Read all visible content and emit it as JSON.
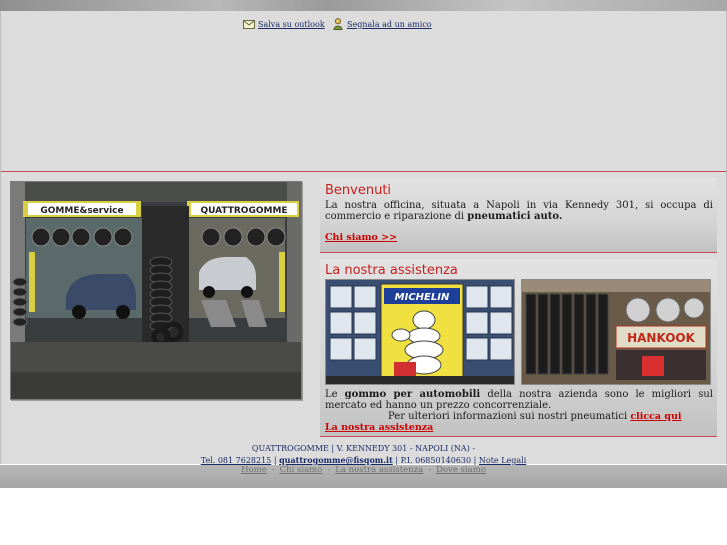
{
  "toplinks": {
    "outlook": "Salva su outlook",
    "friend": "Segnala ad un amico"
  },
  "welcome": {
    "title": "Benvenuti",
    "text_a": "La nostra officina, situata a Napoli in via Kennedy 301, si occupa di commercio e riparazione di ",
    "text_bold": "pneumatici auto.",
    "link": "Chi siamo >>"
  },
  "assist": {
    "title": "La nostra assistenza",
    "text_pre": "Le ",
    "text_bold": "gommo per automobili",
    "text_post": " della nostra azienda sono le migliori sul mercato ed hanno un prezzo concorrenziale.",
    "more": "Per ulteriori informazioni sui nostri pneumatici ",
    "more_link": "clicca qui",
    "link": "La nostra assistenza"
  },
  "photo_signs": {
    "left": "GOMME&service",
    "right": "QUATTROGOMME"
  },
  "thumbs": {
    "michelin": "MICHELIN",
    "hankook": "HANKOOK"
  },
  "footer": {
    "line1": "QUATTROGOMME | V. KENNEDY 301 - NAPOLI (NA) -",
    "tel": "Tel. 081 7628215",
    "sep1": " | ",
    "email": "quattrogomme@fisqom.it",
    "piva": " | P.I. 06850140630 | ",
    "legal": "Note Legali"
  },
  "nav": [
    "Home",
    "Chi siamo",
    "La nostra assistenza",
    "Dove siamo"
  ],
  "colors": {
    "accent": "#c62020",
    "link": "#1a2a66",
    "panel": "#dcdcdc"
  }
}
